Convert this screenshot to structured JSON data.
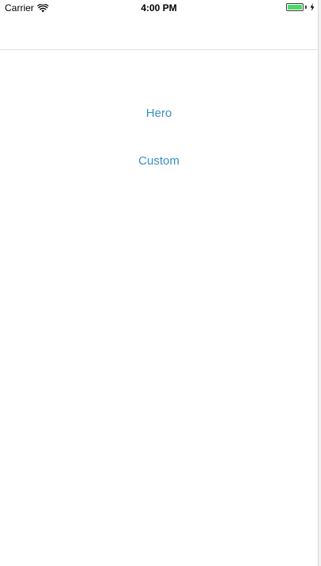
{
  "status_bar": {
    "carrier": "Carrier",
    "time": "4:00 PM",
    "wifi_icon": "wifi-icon",
    "battery_icon": "battery-icon",
    "charging_icon": "charging-bolt-icon",
    "battery_level": 1.0,
    "battery_color": "#4cd964"
  },
  "nav_bar": {
    "title": ""
  },
  "buttons": {
    "hero_label": "Hero",
    "custom_label": "Custom",
    "accent_color": "#3b8fc7"
  }
}
